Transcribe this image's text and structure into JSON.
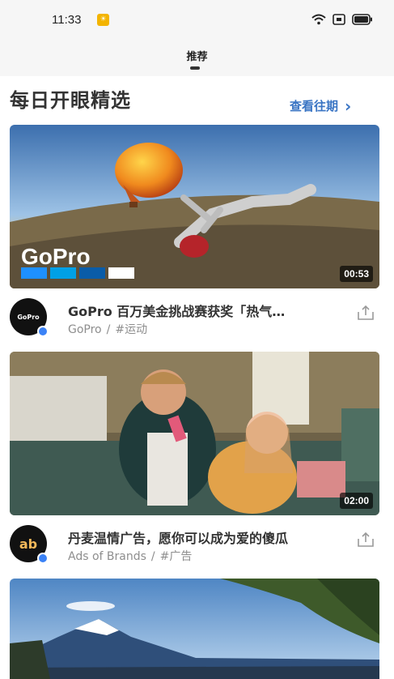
{
  "status_bar": {
    "time": "11:33",
    "notification_badge": "☀"
  },
  "tabs": [
    {
      "label": "推荐",
      "active": true
    }
  ],
  "section": {
    "title": "每日开眼精选",
    "view_past_label": "查看往期",
    "view_past_chevron": "›"
  },
  "videos": [
    {
      "title": "GoPro 百万美金挑战赛获奖「热气…",
      "author": "GoPro",
      "separator": "/",
      "tag": "#运动",
      "duration": "00:53",
      "thumbnail_logo": "GoPro",
      "avatar_text": "GoPro"
    },
    {
      "title": "丹麦温情广告，愿你可以成为爱的傻瓜",
      "author": "Ads of Brands",
      "separator": "/",
      "tag": "#广告",
      "duration": "02:00",
      "avatar_text": "ab"
    },
    {
      "title": "",
      "author": "",
      "separator": "",
      "tag": "",
      "duration": ""
    }
  ],
  "colors": {
    "accent": "#3a75c4",
    "verified": "#3b82f6",
    "muted_text": "#8e8e8e"
  }
}
